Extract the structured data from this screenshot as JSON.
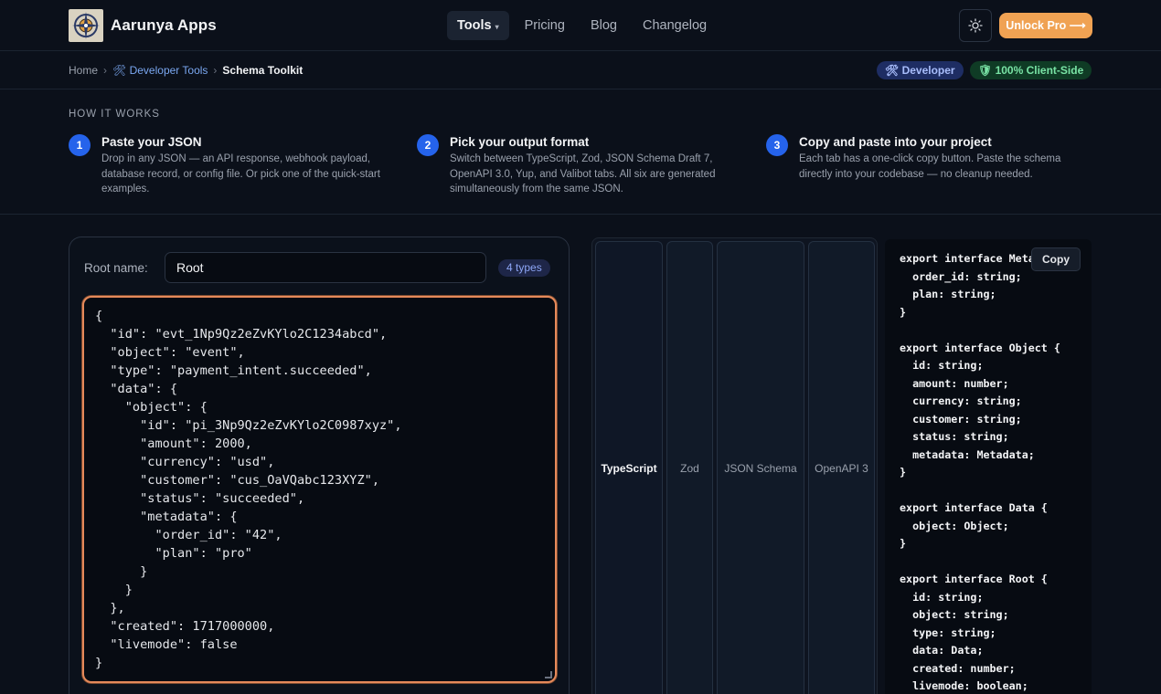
{
  "brand": {
    "name": "Aarunya Apps",
    "logo_icon": "compass-logo-icon"
  },
  "nav": {
    "items": [
      {
        "label": "Tools",
        "active": true,
        "has_caret": true
      },
      {
        "label": "Pricing"
      },
      {
        "label": "Blog"
      },
      {
        "label": "Changelog"
      }
    ],
    "caret": "▾",
    "theme_icon": "sun-icon",
    "unlock_label": "Unlock Pro ⟶"
  },
  "breadcrumb": {
    "home": "Home",
    "sep": "›",
    "developer_tools": "🛠 Developer Tools",
    "current": "Schema Toolkit"
  },
  "badges": {
    "developer": "🛠 Developer",
    "client_side": "🛡 100% Client-Side"
  },
  "how": {
    "title": "HOW IT WORKS",
    "steps": [
      {
        "num": "1",
        "title": "Paste your JSON",
        "desc": "Drop in any JSON — an API response, webhook payload, database record, or config file. Or pick one of the quick-start examples."
      },
      {
        "num": "2",
        "title": "Pick your output format",
        "desc": "Switch between TypeScript, Zod, JSON Schema Draft 7, OpenAPI 3.0, Yup, and Valibot tabs. All six are generated simultaneously from the same JSON."
      },
      {
        "num": "3",
        "title": "Copy and paste into your project",
        "desc": "Each tab has a one-click copy button. Paste the schema directly into your codebase — no cleanup needed."
      }
    ]
  },
  "editor": {
    "root_label": "Root name:",
    "root_value": "Root",
    "types_badge": "4 types",
    "json": "{\n  \"id\": \"evt_1Np9Qz2eZvKYlo2C1234abcd\",\n  \"object\": \"event\",\n  \"type\": \"payment_intent.succeeded\",\n  \"data\": {\n    \"object\": {\n      \"id\": \"pi_3Np9Qz2eZvKYlo2C0987xyz\",\n      \"amount\": 2000,\n      \"currency\": \"usd\",\n      \"customer\": \"cus_OaVQabc123XYZ\",\n      \"status\": \"succeeded\",\n      \"metadata\": {\n        \"order_id\": \"42\",\n        \"plan\": \"pro\"\n      }\n    }\n  },\n  \"created\": 1717000000,\n  \"livemode\": false\n}"
  },
  "tabs": [
    {
      "label": "TypeScript",
      "active": true
    },
    {
      "label": "Zod"
    },
    {
      "label": "JSON Schema"
    },
    {
      "label": "OpenAPI 3"
    }
  ],
  "output": {
    "copy_label": "Copy",
    "code": "export interface Metadata {\n  order_id: string;\n  plan: string;\n}\n\nexport interface Object {\n  id: string;\n  amount: number;\n  currency: string;\n  customer: string;\n  status: string;\n  metadata: Metadata;\n}\n\nexport interface Data {\n  object: Object;\n}\n\nexport interface Root {\n  id: string;\n  object: string;\n  type: string;\n  data: Data;\n  created: number;\n  livemode: boolean;"
  },
  "colors": {
    "accent": "#2563eb",
    "unlock": "#f0a253",
    "editor_border": "#e5895a"
  }
}
